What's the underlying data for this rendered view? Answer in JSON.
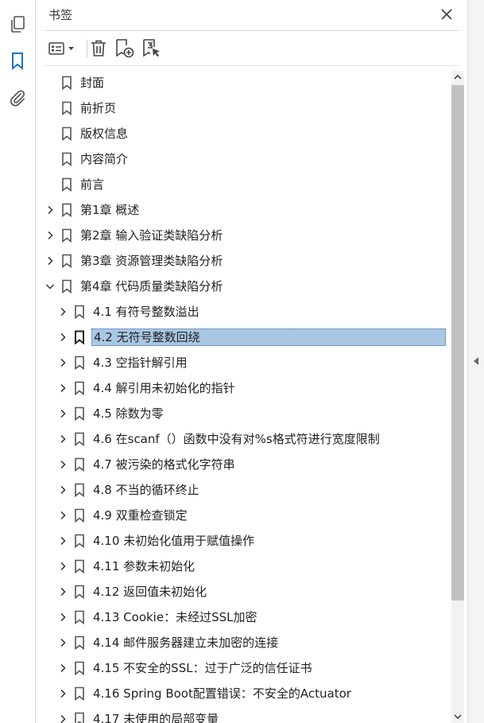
{
  "panel": {
    "title": "书签"
  },
  "icons": {
    "rail": [
      "pages-icon",
      "bookmark-icon",
      "attachment-icon"
    ],
    "toolbar": [
      "options-icon",
      "delete-icon",
      "new-bookmark-icon",
      "bookmark-from-selection-icon"
    ],
    "accent": "#1a73c8",
    "selection": "#a9c8e6"
  },
  "bookmarks": [
    {
      "label": "封面",
      "level": 0,
      "expander": "none"
    },
    {
      "label": "前折页",
      "level": 0,
      "expander": "none"
    },
    {
      "label": "版权信息",
      "level": 0,
      "expander": "none"
    },
    {
      "label": "内容简介",
      "level": 0,
      "expander": "none"
    },
    {
      "label": "前言",
      "level": 0,
      "expander": "none"
    },
    {
      "label": "第1章 概述",
      "level": 0,
      "expander": "collapsed"
    },
    {
      "label": "第2章 输入验证类缺陷分析",
      "level": 0,
      "expander": "collapsed"
    },
    {
      "label": "第3章 资源管理类缺陷分析",
      "level": 0,
      "expander": "collapsed"
    },
    {
      "label": "第4章 代码质量类缺陷分析",
      "level": 0,
      "expander": "expanded"
    },
    {
      "label": "4.1 有符号整数溢出",
      "level": 1,
      "expander": "collapsed"
    },
    {
      "label": "4.2 无符号整数回绕",
      "level": 1,
      "expander": "collapsed",
      "selected": true
    },
    {
      "label": "4.3 空指针解引用",
      "level": 1,
      "expander": "collapsed"
    },
    {
      "label": "4.4 解引用未初始化的指针",
      "level": 1,
      "expander": "collapsed"
    },
    {
      "label": "4.5 除数为零",
      "level": 1,
      "expander": "collapsed"
    },
    {
      "label": "4.6 在scanf（）函数中没有对%s格式符进行宽度限制",
      "level": 1,
      "expander": "collapsed"
    },
    {
      "label": "4.7 被污染的格式化字符串",
      "level": 1,
      "expander": "collapsed"
    },
    {
      "label": "4.8 不当的循环终止",
      "level": 1,
      "expander": "collapsed"
    },
    {
      "label": "4.9 双重检查锁定",
      "level": 1,
      "expander": "collapsed"
    },
    {
      "label": "4.10 未初始化值用于赋值操作",
      "level": 1,
      "expander": "collapsed"
    },
    {
      "label": "4.11 参数未初始化",
      "level": 1,
      "expander": "collapsed"
    },
    {
      "label": "4.12 返回值未初始化",
      "level": 1,
      "expander": "collapsed"
    },
    {
      "label": "4.13 Cookie：未经过SSL加密",
      "level": 1,
      "expander": "collapsed"
    },
    {
      "label": "4.14 邮件服务器建立未加密的连接",
      "level": 1,
      "expander": "collapsed"
    },
    {
      "label": "4.15 不安全的SSL：过于广泛的信任证书",
      "level": 1,
      "expander": "collapsed"
    },
    {
      "label": "4.16 Spring Boot配置错误：不安全的Actuator",
      "level": 1,
      "expander": "collapsed"
    },
    {
      "label": "4.17 未使用的局部变量",
      "level": 1,
      "expander": "collapsed"
    }
  ]
}
